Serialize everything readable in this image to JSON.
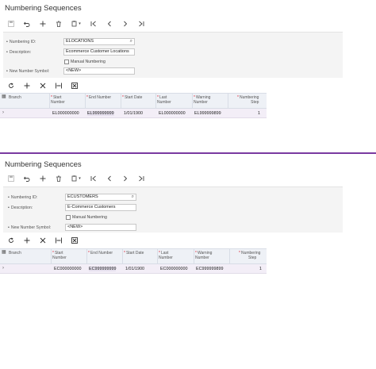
{
  "panels": [
    {
      "title": "Numbering Sequences",
      "form": {
        "numbering_id_label": "Numbering ID:",
        "numbering_id_value": "ELOCATIONS",
        "description_label": "Description:",
        "description_value": "Ecommerce Customer Locations",
        "manual_numbering_label": "Manual Numbering",
        "new_number_symbol_label": "New Number Symbol:",
        "new_number_symbol_value": "<NEW>"
      },
      "columns": {
        "branch": "Branch",
        "start_number": [
          "Start",
          "Number"
        ],
        "end_number": "End Number",
        "start_date": "Start Date",
        "last_number": [
          "Last",
          "Number"
        ],
        "warning_number": [
          "Warning",
          "Number"
        ],
        "numbering_step": [
          "Numbering",
          "Step"
        ]
      },
      "rows": [
        {
          "branch": "",
          "start_number": "EL000000000",
          "end_number": "EL999999999",
          "start_date": "1/01/1900",
          "last_number": "EL000000000",
          "warning_number": "EL999999899",
          "numbering_step": "1"
        }
      ]
    },
    {
      "title": "Numbering Sequences",
      "form": {
        "numbering_id_label": "Numbering ID:",
        "numbering_id_value": "ECUSTOMERS",
        "description_label": "Description:",
        "description_value": "E-Commerce Customers",
        "manual_numbering_label": "Manual Numbering",
        "new_number_symbol_label": "New Number Symbol:",
        "new_number_symbol_value": "<NEW>"
      },
      "columns": {
        "branch": "Branch",
        "start_number": [
          "Start",
          "Number"
        ],
        "end_number": "End Number",
        "start_date": "Start Date",
        "last_number": [
          "Last",
          "Number"
        ],
        "warning_number": [
          "Warning",
          "Number"
        ],
        "numbering_step": [
          "Numbering",
          "Step"
        ]
      },
      "rows": [
        {
          "branch": "",
          "start_number": "EC000000000",
          "end_number": "EC999999999",
          "start_date": "1/01/1900",
          "last_number": "EC000000000",
          "warning_number": "EC999999899",
          "numbering_step": "1"
        }
      ]
    }
  ],
  "colors": {
    "accent_divider": "#7a3aa0",
    "row_selected": "#f3eef7",
    "header_bg": "#eef1f6"
  },
  "icons": {
    "toolbar": [
      "save-icon",
      "undo-icon",
      "add-icon",
      "delete-icon",
      "copy-paste-icon",
      "first-icon",
      "previous-icon",
      "next-icon",
      "last-icon"
    ],
    "grid": [
      "refresh-icon",
      "add-row-icon",
      "delete-row-icon",
      "fit-columns-icon",
      "export-icon"
    ]
  }
}
